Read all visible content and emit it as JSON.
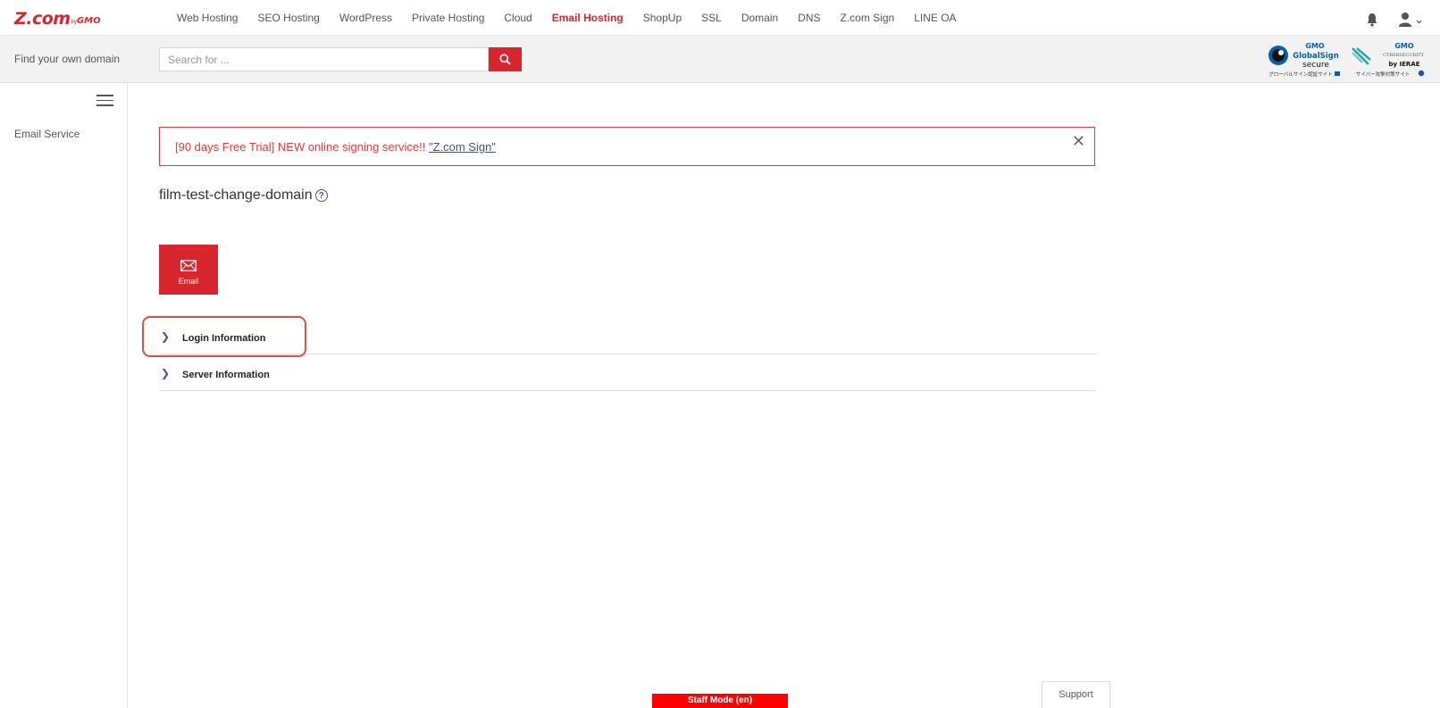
{
  "brand": {
    "main": "Z.com",
    "by": "by",
    "gmo": "GMO",
    "color": "#d8262e"
  },
  "nav": {
    "items": [
      {
        "label": "Web Hosting",
        "active": false
      },
      {
        "label": "SEO Hosting",
        "active": false
      },
      {
        "label": "WordPress",
        "active": false
      },
      {
        "label": "Private Hosting",
        "active": false
      },
      {
        "label": "Cloud",
        "active": false
      },
      {
        "label": "Email Hosting",
        "active": true
      },
      {
        "label": "ShopUp",
        "active": false
      },
      {
        "label": "SSL",
        "active": false
      },
      {
        "label": "Domain",
        "active": false
      },
      {
        "label": "DNS",
        "active": false
      },
      {
        "label": "Z.com Sign",
        "active": false
      },
      {
        "label": "LINE OA",
        "active": false
      }
    ],
    "icons": [
      "bell-icon",
      "user-icon"
    ]
  },
  "search": {
    "label": "Find your own domain",
    "placeholder": "Search for ...",
    "button_icon": "search-icon"
  },
  "badges": {
    "globalsign": {
      "top": "GMO",
      "line1": "GlobalSign",
      "line2": "secure",
      "caption": "グローバルサイン認証サイト"
    },
    "cybersecurity": {
      "top": "GMO",
      "line1": "CYBERSECURITY",
      "line2": "by IERAE",
      "caption": "サイバー攻撃対策サイト"
    }
  },
  "sidebar": {
    "items": [
      {
        "label": "Email Service"
      }
    ]
  },
  "banner": {
    "text": "[90 days Free Trial] NEW online signing service!! ",
    "link": "\"Z.com Sign\"",
    "close": "✕"
  },
  "main": {
    "domain": "film-test-change-domain",
    "help": "?",
    "tile_label": "Email",
    "accordion": [
      {
        "label": "Login Information",
        "chevron": "❯"
      },
      {
        "label": "Server Information",
        "chevron": "❯"
      }
    ]
  },
  "footer": {
    "staff_mode": "Staff Mode (en)",
    "support": "Support"
  }
}
